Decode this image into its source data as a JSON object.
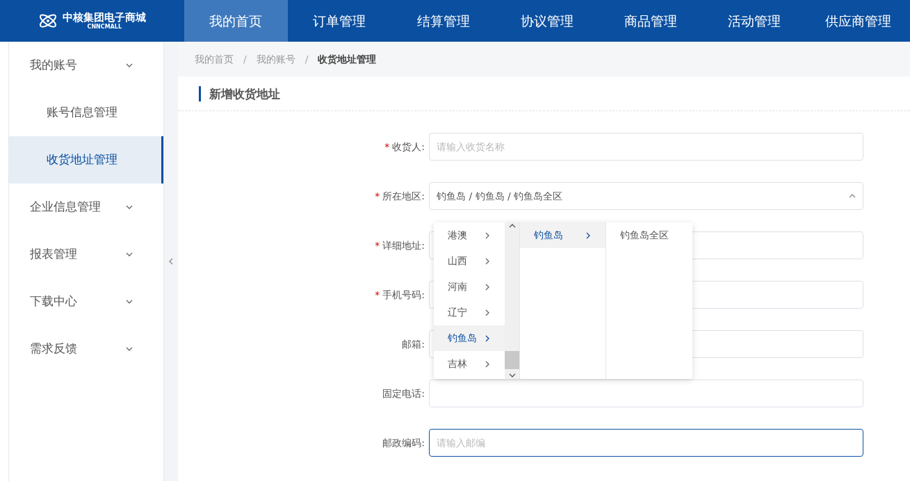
{
  "header": {
    "logo_name": "中核集团电子商城",
    "logo_subtitle": "CNNCMALL"
  },
  "nav": [
    {
      "label": "我的首页",
      "selected": true
    },
    {
      "label": "订单管理",
      "selected": false
    },
    {
      "label": "结算管理",
      "selected": false
    },
    {
      "label": "协议管理",
      "selected": false
    },
    {
      "label": "商品管理",
      "selected": false
    },
    {
      "label": "活动管理",
      "selected": false
    },
    {
      "label": "供应商管理",
      "selected": false
    }
  ],
  "sidebar": {
    "items": [
      {
        "label": "我的账号",
        "expanded": true,
        "children": [
          {
            "label": "账号信息管理",
            "selected": false
          },
          {
            "label": "收货地址管理",
            "selected": true
          }
        ]
      },
      {
        "label": "企业信息管理"
      },
      {
        "label": "报表管理"
      },
      {
        "label": "下载中心"
      },
      {
        "label": "需求反馈"
      }
    ]
  },
  "breadcrumb": [
    {
      "kind": "link",
      "label": "我的首页"
    },
    {
      "kind": "separator",
      "label": "/"
    },
    {
      "kind": "link",
      "label": "我的账号"
    },
    {
      "kind": "separator",
      "label": "/"
    },
    {
      "kind": "current",
      "label": "收货地址管理"
    }
  ],
  "section_title": "新增收货地址",
  "form": [
    {
      "kind": "text",
      "label": "收货人:",
      "required_mark": "*",
      "placeholder": "请输入收货名称",
      "focused": false
    },
    {
      "kind": "select",
      "label": "所在地区:",
      "required_mark": "*",
      "value": "钓鱼岛 / 钓鱼岛 / 钓鱼岛全区",
      "focused": false,
      "open": true
    },
    {
      "kind": "text",
      "label": "详细地址:",
      "required_mark": "*",
      "focused": false
    },
    {
      "kind": "text",
      "label": "手机号码:",
      "required_mark": "*",
      "focused": false
    },
    {
      "kind": "text",
      "label": "邮箱:",
      "focused": false
    },
    {
      "kind": "text",
      "label": "固定电话:",
      "focused": false
    },
    {
      "kind": "text",
      "label": "邮政编码:",
      "placeholder": "请输入邮编",
      "focused": true
    }
  ],
  "cascader": [
    {
      "scrollable": true,
      "items": [
        {
          "label": "港澳",
          "selected": false,
          "has_children": true
        },
        {
          "label": "山西",
          "selected": false,
          "has_children": true
        },
        {
          "label": "河南",
          "selected": false,
          "has_children": true
        },
        {
          "label": "辽宁",
          "selected": false,
          "has_children": true
        },
        {
          "label": "钓鱼岛",
          "selected": true,
          "has_children": true
        },
        {
          "label": "吉林",
          "selected": false,
          "has_children": true
        }
      ]
    },
    {
      "scrollable": false,
      "items": [
        {
          "label": "钓鱼岛",
          "selected": true,
          "has_children": true
        }
      ]
    },
    {
      "scrollable": false,
      "items": [
        {
          "label": "钓鱼岛全区",
          "selected": false,
          "has_children": false
        }
      ]
    }
  ]
}
